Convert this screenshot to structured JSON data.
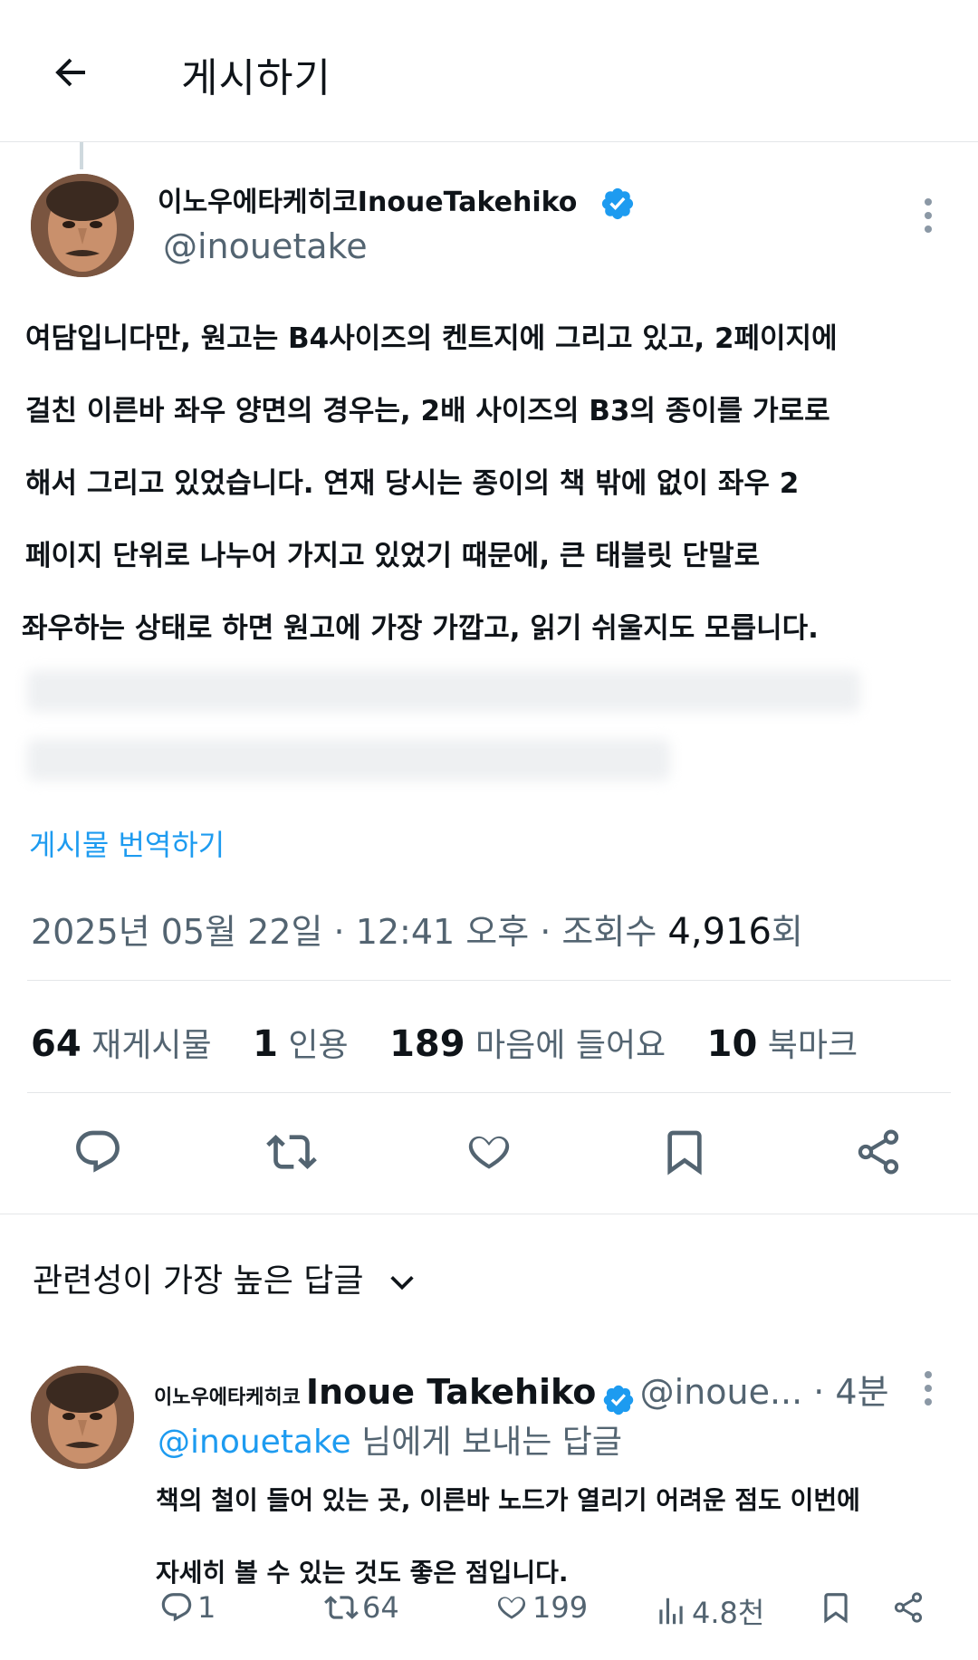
{
  "header": {
    "title": "게시하기"
  },
  "post": {
    "author_name": "이노우에타케히코InoueTakehiko",
    "author_handle": "@inouetake",
    "body_lines": [
      "여담입니다만, 원고는 B4사이즈의 켄트지에 그리고 있고, 2페이지에",
      "걸친 이른바 좌우 양면의 경우는, 2배 사이즈의 B3의 종이를 가로로",
      "해서 그리고 있었습니다. 연재 당시는 종이의 책 밖에 없이 좌우 2",
      "페이지 단위로 나누어 가지고 있었기 때문에, 큰 태블릿 단말로",
      "좌우하는 상태로 하면 원고에 가장 가깝고, 읽기 쉬울지도 모릅니다."
    ],
    "translate_label": "게시물 번역하기",
    "timestamp": "2025년 05월 22일 · 12:41 오후 · 조회수 ",
    "views_count": "4,916",
    "views_suffix": "회",
    "stats": {
      "reposts_count": "64",
      "reposts_label": "재게시물",
      "quotes_count": "1",
      "quotes_label": "인용",
      "likes_count": "189",
      "likes_label": "마음에 들어요",
      "bookmarks_count": "10",
      "bookmarks_label": "북마크"
    }
  },
  "replies_section": {
    "sort_label": "관련성이 가장 높은 답글"
  },
  "reply": {
    "author_name_jp": "이노우에타케히코",
    "author_name_en": "Inoue Takehiko",
    "author_handle": "@inoue...",
    "time": " · 4분",
    "reply_to_mention": "@inouetake",
    "reply_to_suffix": " 님에게 보내는 답글",
    "body_lines": [
      "책의 철이 들어 있는 곳, 이른바 노드가 열리기 어려운 점도 이번에",
      "자세히 볼 수 있는 것도 좋은 점입니다."
    ],
    "stats": {
      "replies": "1",
      "reposts": "64",
      "likes": "199",
      "views": "4.8천"
    }
  },
  "colors": {
    "accent": "#1d9bf0",
    "secondary_text": "#536471",
    "primary_text": "#0f1419",
    "divider": "#e4e6e8"
  },
  "icons": [
    "back-arrow-icon",
    "verified-badge-icon",
    "more-vertical-icon",
    "reply-icon",
    "repost-icon",
    "like-icon",
    "bookmark-icon",
    "share-icon",
    "chevron-down-icon",
    "views-icon"
  ]
}
